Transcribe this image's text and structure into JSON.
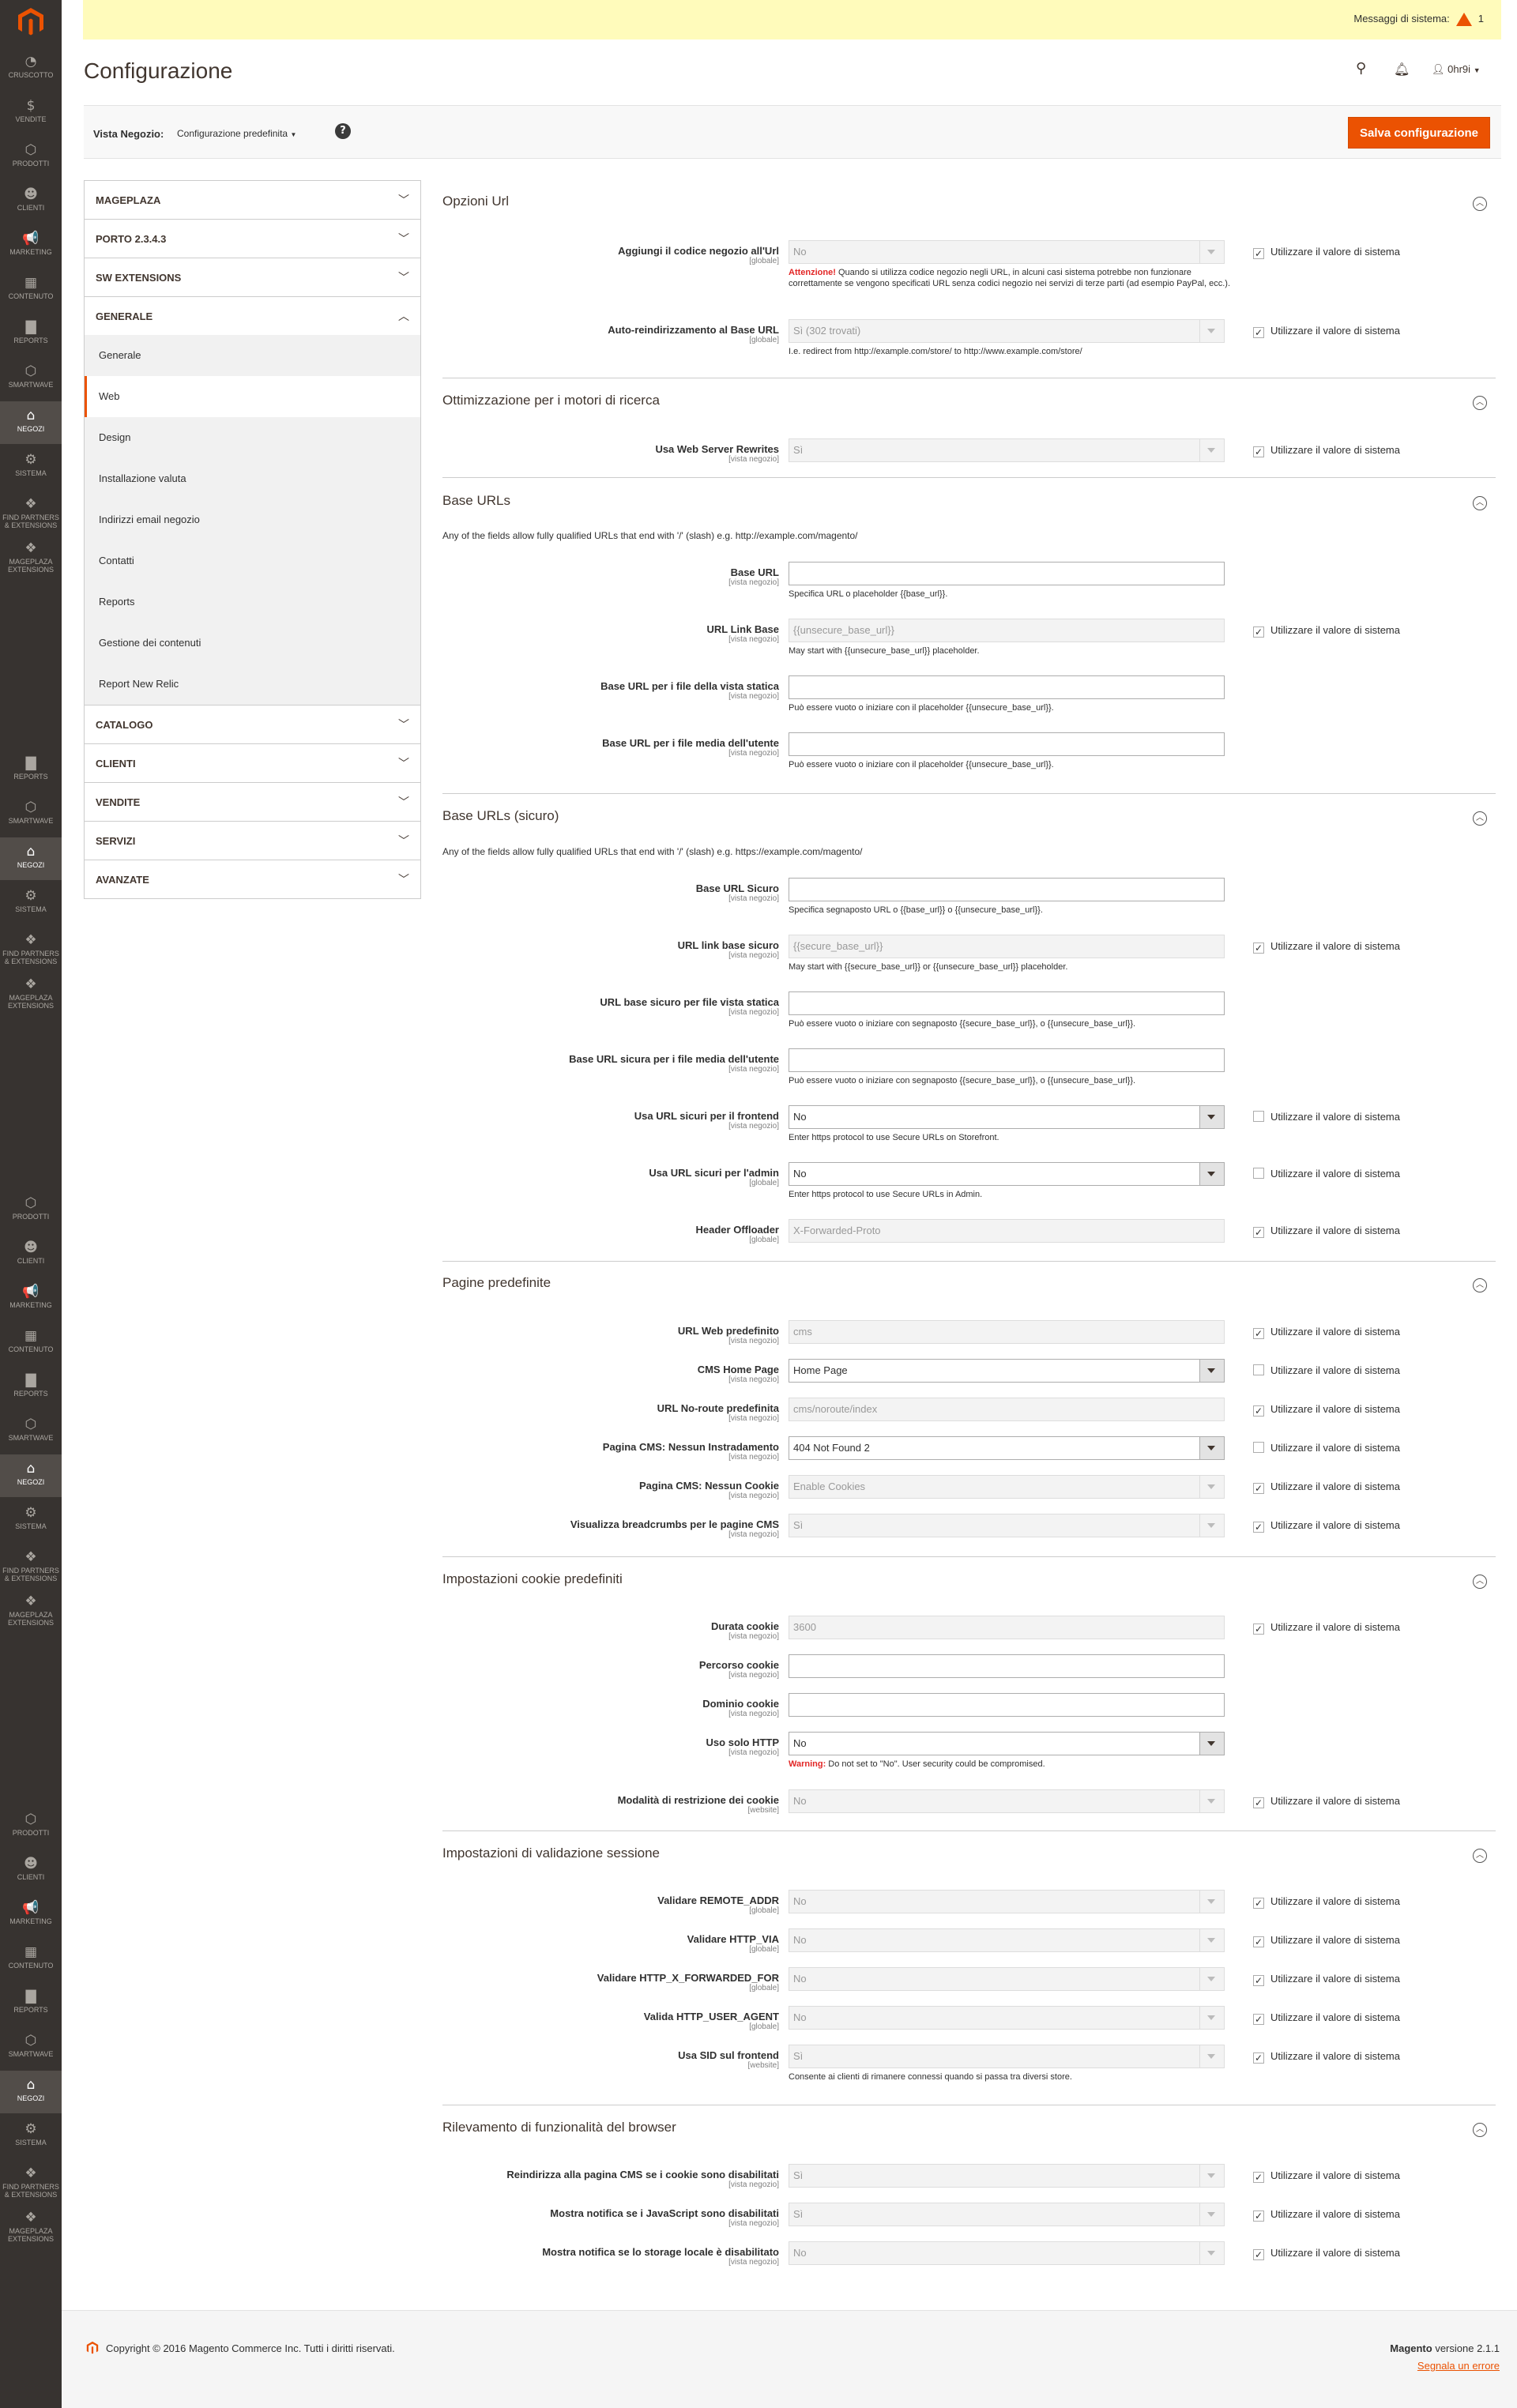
{
  "sidebar": {
    "groups": [
      [
        {
          "icon": "dashboard-icon",
          "glyph": "◔",
          "label": "CRUSCOTTO"
        },
        {
          "icon": "dollar-icon",
          "glyph": "$",
          "label": "VENDITE"
        },
        {
          "icon": "cube-icon",
          "glyph": "⬡",
          "label": "PRODOTTI"
        },
        {
          "icon": "person-icon",
          "glyph": "☻",
          "label": "CLIENTI"
        },
        {
          "icon": "megaphone-icon",
          "glyph": "📢",
          "label": "MARKETING"
        },
        {
          "icon": "layout-icon",
          "glyph": "▦",
          "label": "CONTENUTO"
        },
        {
          "icon": "bar-chart-icon",
          "glyph": "▇",
          "label": "REPORTS"
        },
        {
          "icon": "hexagon-icon",
          "glyph": "⬡",
          "label": "SMARTWAVE"
        },
        {
          "icon": "store-icon",
          "glyph": "⌂",
          "label": "NEGOZI",
          "active": true
        },
        {
          "icon": "gear-icon",
          "glyph": "⚙",
          "label": "SISTEMA"
        },
        {
          "icon": "puzzle-icon",
          "glyph": "❖",
          "label": "FIND PARTNERS & EXTENSIONS"
        },
        {
          "icon": "puzzle-icon",
          "glyph": "❖",
          "label": "MAGEPLAZA EXTENSIONS"
        }
      ]
    ]
  },
  "topbar": {
    "system_messages_label": "Messaggi di sistema:",
    "system_messages_count": "1"
  },
  "header": {
    "title": "Configurazione",
    "user": "0hr9i"
  },
  "scope": {
    "label": "Vista Negozio:",
    "value": "Configurazione predefinita",
    "help": "?"
  },
  "actions": {
    "save": "Salva configurazione"
  },
  "tabs": [
    {
      "label": "MAGEPLAZA",
      "open": false
    },
    {
      "label": "PORTO 2.3.4.3",
      "open": false
    },
    {
      "label": "SW EXTENSIONS",
      "open": false
    },
    {
      "label": "GENERALE",
      "open": true,
      "items": [
        "Generale",
        "Web",
        "Design",
        "Installazione valuta",
        "Indirizzi email negozio",
        "Contatti",
        "Reports",
        "Gestione dei contenuti",
        "Report New Relic"
      ],
      "active_item": "Web"
    },
    {
      "label": "CATALOGO",
      "open": false
    },
    {
      "label": "CLIENTI",
      "open": false
    },
    {
      "label": "VENDITE",
      "open": false
    },
    {
      "label": "SERVIZI",
      "open": false
    },
    {
      "label": "AVANZATE",
      "open": false
    }
  ],
  "use_system_label": "Utilizzare il valore di sistema",
  "sections": [
    {
      "title": "Opzioni Url",
      "fields": [
        {
          "label": "Aggiungi il codice negozio all'Url",
          "scope": "[globale]",
          "value": "No",
          "type": "select",
          "disabled": true,
          "check": true,
          "note_strong": "Attenzione!",
          "note": " Quando si utilizza codice negozio negli URL, in alcuni casi sistema potrebbe non funzionare correttamente se vengono specificati URL senza codici negozio nei servizi di terze parti (ad esempio PayPal, ecc.)."
        },
        {
          "label": "Auto-reindirizzamento al Base URL",
          "scope": "[globale]",
          "value": "Sì (302 trovati)",
          "type": "select",
          "disabled": true,
          "check": true,
          "note": "I.e. redirect from http://example.com/store/ to http://www.example.com/store/"
        }
      ]
    },
    {
      "title": "Ottimizzazione per i motori di ricerca",
      "fields": [
        {
          "label": "Usa Web Server Rewrites",
          "scope": "[vista negozio]",
          "value": "Sì",
          "type": "select",
          "disabled": true,
          "check": true
        }
      ]
    },
    {
      "title": "Base URLs",
      "note": "Any of the fields allow fully qualified URLs that end with '/' (slash) e.g. http://example.com/magento/",
      "fields": [
        {
          "label": "Base URL",
          "scope": "[vista negozio]",
          "value": "",
          "type": "text",
          "disabled": false,
          "check": null,
          "note": "Specifica URL o placeholder {{base_url}}."
        },
        {
          "label": "URL Link Base",
          "scope": "[vista negozio]",
          "value": "{{unsecure_base_url}}",
          "type": "text",
          "disabled": true,
          "check": true,
          "note": "May start with {{unsecure_base_url}} placeholder."
        },
        {
          "label": "Base URL per i file della vista statica",
          "scope": "[vista negozio]",
          "value": "",
          "type": "text",
          "disabled": false,
          "check": null,
          "note": "Può essere vuoto o iniziare con il placeholder {{unsecure_base_url}}."
        },
        {
          "label": "Base URL per i file media dell'utente",
          "scope": "[vista negozio]",
          "value": "",
          "type": "text",
          "disabled": false,
          "check": null,
          "note": "Può essere vuoto o iniziare con il placeholder {{unsecure_base_url}}."
        }
      ]
    },
    {
      "title": "Base URLs (sicuro)",
      "note": "Any of the fields allow fully qualified URLs that end with '/' (slash) e.g. https://example.com/magento/",
      "fields": [
        {
          "label": "Base URL Sicuro",
          "scope": "[vista negozio]",
          "value": "",
          "type": "text",
          "disabled": false,
          "check": null,
          "note": "Specifica segnaposto URL o {{base_url}} o {{unsecure_base_url}}."
        },
        {
          "label": "URL link base sicuro",
          "scope": "[vista negozio]",
          "value": "{{secure_base_url}}",
          "type": "text",
          "disabled": true,
          "check": true,
          "note": "May start with {{secure_base_url}} or {{unsecure_base_url}} placeholder."
        },
        {
          "label": "URL base sicuro per file vista statica",
          "scope": "[vista negozio]",
          "value": "",
          "type": "text",
          "disabled": false,
          "check": null,
          "note": "Può essere vuoto o iniziare con segnaposto {{secure_base_url}}, o {{unsecure_base_url}}."
        },
        {
          "label": "Base URL sicura per i file media dell'utente",
          "scope": "[vista negozio]",
          "value": "",
          "type": "text",
          "disabled": false,
          "check": null,
          "note": "Può essere vuoto o iniziare con segnaposto {{secure_base_url}}, o {{unsecure_base_url}}."
        },
        {
          "label": "Usa URL sicuri per il frontend",
          "scope": "[vista negozio]",
          "value": "No",
          "type": "select",
          "disabled": false,
          "check": false,
          "note": "Enter https protocol to use Secure URLs on Storefront."
        },
        {
          "label": "Usa URL sicuri per l'admin",
          "scope": "[globale]",
          "value": "No",
          "type": "select",
          "disabled": false,
          "check": false,
          "note": "Enter https protocol to use Secure URLs in Admin."
        },
        {
          "label": "Header Offloader",
          "scope": "[globale]",
          "value": "X-Forwarded-Proto",
          "type": "text",
          "disabled": true,
          "check": true
        }
      ]
    },
    {
      "title": "Pagine predefinite",
      "fields": [
        {
          "label": "URL Web predefinito",
          "scope": "[vista negozio]",
          "value": "cms",
          "type": "text",
          "disabled": true,
          "check": true
        },
        {
          "label": "CMS Home Page",
          "scope": "[vista negozio]",
          "value": "Home Page",
          "type": "select",
          "disabled": false,
          "check": false
        },
        {
          "label": "URL No-route predefinita",
          "scope": "[vista negozio]",
          "value": "cms/noroute/index",
          "type": "text",
          "disabled": true,
          "check": true
        },
        {
          "label": "Pagina CMS: Nessun Instradamento",
          "scope": "[vista negozio]",
          "value": "404 Not Found 2",
          "type": "select",
          "disabled": false,
          "check": false
        },
        {
          "label": "Pagina CMS: Nessun Cookie",
          "scope": "[vista negozio]",
          "value": "Enable Cookies",
          "type": "select",
          "disabled": true,
          "check": true
        },
        {
          "label": "Visualizza breadcrumbs per le pagine CMS",
          "scope": "[vista negozio]",
          "value": "Sì",
          "type": "select",
          "disabled": true,
          "check": true
        }
      ]
    },
    {
      "title": "Impostazioni cookie predefiniti",
      "fields": [
        {
          "label": "Durata cookie",
          "scope": "[vista negozio]",
          "value": "3600",
          "type": "text",
          "disabled": true,
          "check": true
        },
        {
          "label": "Percorso cookie",
          "scope": "[vista negozio]",
          "value": "",
          "type": "text",
          "disabled": false,
          "check": null
        },
        {
          "label": "Dominio cookie",
          "scope": "[vista negozio]",
          "value": "",
          "type": "text",
          "disabled": false,
          "check": null
        },
        {
          "label": "Uso solo HTTP",
          "scope": "[vista negozio]",
          "value": "No",
          "type": "select",
          "disabled": false,
          "check": null,
          "note_strong": "Warning:",
          "note": " Do not set to \"No\". User security could be compromised."
        },
        {
          "label": "Modalità di restrizione dei cookie",
          "scope": "[website]",
          "value": "No",
          "type": "select",
          "disabled": true,
          "check": true
        }
      ]
    },
    {
      "title": "Impostazioni di validazione sessione",
      "fields": [
        {
          "label": "Validare REMOTE_ADDR",
          "scope": "[globale]",
          "value": "No",
          "type": "select",
          "disabled": true,
          "check": true
        },
        {
          "label": "Validare HTTP_VIA",
          "scope": "[globale]",
          "value": "No",
          "type": "select",
          "disabled": true,
          "check": true
        },
        {
          "label": "Validare HTTP_X_FORWARDED_FOR",
          "scope": "[globale]",
          "value": "No",
          "type": "select",
          "disabled": true,
          "check": true
        },
        {
          "label": "Valida HTTP_USER_AGENT",
          "scope": "[globale]",
          "value": "No",
          "type": "select",
          "disabled": true,
          "check": true
        },
        {
          "label": "Usa SID sul frontend",
          "scope": "[website]",
          "value": "Sì",
          "type": "select",
          "disabled": true,
          "check": true,
          "note": "Consente ai clienti di rimanere connessi quando si passa tra diversi store."
        }
      ]
    },
    {
      "title": "Rilevamento di funzionalità del browser",
      "fields": [
        {
          "label": "Reindirizza alla pagina CMS se i cookie sono disabilitati",
          "scope": "[vista negozio]",
          "value": "Sì",
          "type": "select",
          "disabled": true,
          "check": true
        },
        {
          "label": "Mostra notifica se i JavaScript sono disabilitati",
          "scope": "[vista negozio]",
          "value": "Sì",
          "type": "select",
          "disabled": true,
          "check": true
        },
        {
          "label": "Mostra notifica se lo storage locale è disabilitato",
          "scope": "[vista negozio]",
          "value": "No",
          "type": "select",
          "disabled": true,
          "check": true
        }
      ]
    }
  ],
  "footer": {
    "copyright": "Copyright © 2016 Magento Commerce Inc. Tutti i diritti riservati.",
    "version_brand": "Magento",
    "version": " versione 2.1.1",
    "report": "Segnala un errore"
  }
}
